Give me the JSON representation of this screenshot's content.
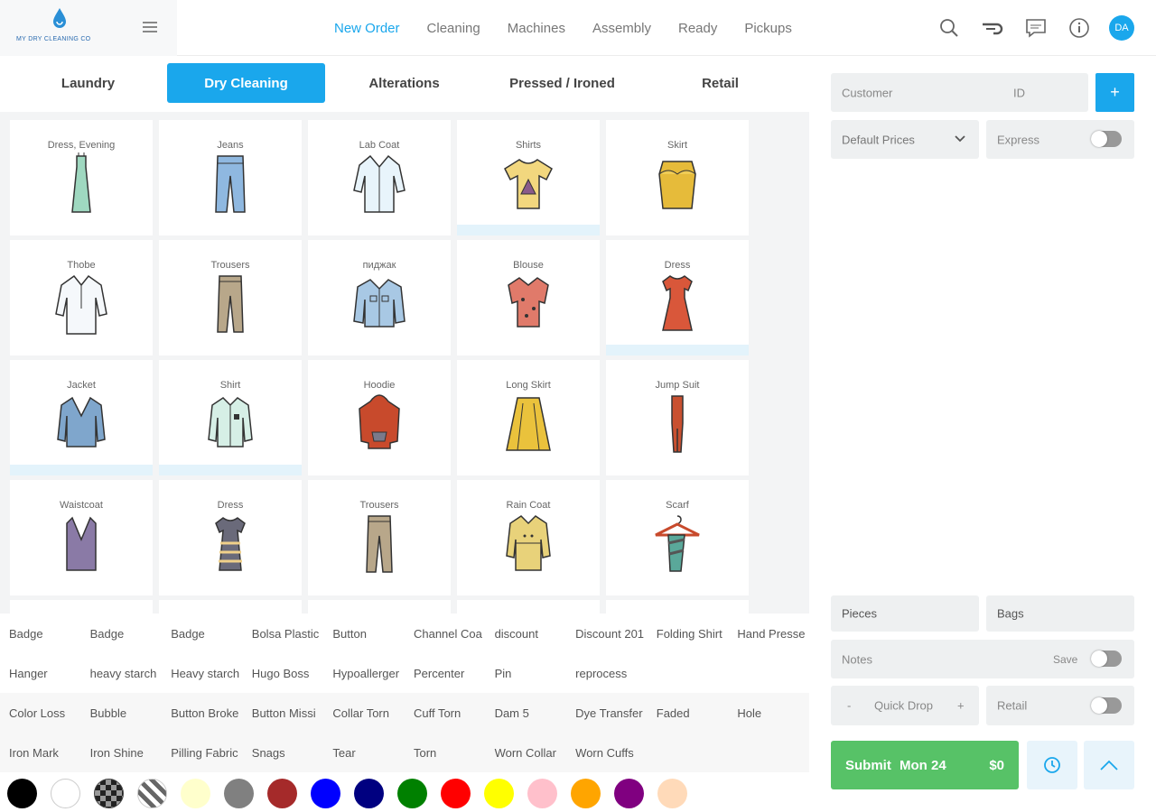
{
  "brand": {
    "name": "MY DRY CLEANING CO"
  },
  "nav": {
    "items": [
      {
        "label": "New Order"
      },
      {
        "label": "Cleaning"
      },
      {
        "label": "Machines"
      },
      {
        "label": "Assembly"
      },
      {
        "label": "Ready"
      },
      {
        "label": "Pickups"
      }
    ],
    "active": "New Order"
  },
  "user": {
    "initials": "DA"
  },
  "icons": [
    "menu-icon",
    "search-icon",
    "delivery-icon",
    "chat-icon",
    "info-icon"
  ],
  "categories": {
    "items": [
      {
        "label": "Laundry"
      },
      {
        "label": "Dry Cleaning"
      },
      {
        "label": "Alterations"
      },
      {
        "label": "Pressed / Ironed"
      },
      {
        "label": "Retail"
      }
    ],
    "active": "Dry Cleaning"
  },
  "items": [
    {
      "label": "Dress, Evening",
      "icon": "evening-dress-icon",
      "selected": false
    },
    {
      "label": "Jeans",
      "icon": "jeans-icon",
      "selected": false
    },
    {
      "label": "Lab Coat",
      "icon": "lab-coat-icon",
      "selected": false
    },
    {
      "label": "Shirts",
      "icon": "tshirt-icon",
      "selected": true
    },
    {
      "label": "Skirt",
      "icon": "skirt-icon",
      "selected": false
    },
    {
      "label": "Thobe",
      "icon": "thobe-icon",
      "selected": false
    },
    {
      "label": "Trousers",
      "icon": "trousers-icon",
      "selected": false
    },
    {
      "label": "пиджак",
      "icon": "denim-jacket-icon",
      "selected": false
    },
    {
      "label": "Blouse",
      "icon": "blouse-icon",
      "selected": false
    },
    {
      "label": "Dress",
      "icon": "dress-icon",
      "selected": true
    },
    {
      "label": "Jacket",
      "icon": "blazer-icon",
      "selected": true
    },
    {
      "label": "Shirt",
      "icon": "shirt-icon",
      "selected": true
    },
    {
      "label": "Hoodie",
      "icon": "hoodie-icon",
      "selected": false
    },
    {
      "label": "Long Skirt",
      "icon": "long-skirt-icon",
      "selected": false
    },
    {
      "label": "Jump Suit",
      "icon": "jumpsuit-icon",
      "selected": false
    },
    {
      "label": "Waistcoat",
      "icon": "waistcoat-icon",
      "selected": false
    },
    {
      "label": "Dress",
      "icon": "striped-dress-icon",
      "selected": false
    },
    {
      "label": "Trousers",
      "icon": "trousers-icon",
      "selected": false
    },
    {
      "label": "Rain Coat",
      "icon": "raincoat-icon",
      "selected": false
    },
    {
      "label": "Scarf",
      "icon": "scarf-hanger-icon",
      "selected": false
    }
  ],
  "tags": [
    [
      "Badge",
      "Badge",
      "Badge",
      "Bolsa Plastic",
      "Button",
      "Channel Coa",
      "discount",
      "Discount 201",
      "Folding Shirt",
      "Hand Presse"
    ],
    [
      "Hanger",
      "heavy starch",
      "Heavy starch",
      "Hugo Boss",
      "Hypoallerger",
      "Percenter",
      "Pin",
      "reprocess"
    ],
    [
      "Color Loss",
      "Bubble",
      "Button Broke",
      "Button Missi",
      "Collar Torn",
      "Cuff Torn",
      "Dam 5",
      "Dye Transfer",
      "Faded",
      "Hole"
    ],
    [
      "Iron Mark",
      "Iron Shine",
      "Pilling Fabric",
      "Snags",
      "Tear",
      "Torn",
      "Worn Collar",
      "Worn Cuffs"
    ]
  ],
  "colors": [
    "#000000",
    "#ffffff",
    "checkered",
    "striped",
    "#ffffcc",
    "#808080",
    "#a52a2a",
    "#0000ff",
    "#000080",
    "#008000",
    "#ff0000",
    "#ffff00",
    "#ffc0cb",
    "#ffa500",
    "#800080",
    "#ffdab9"
  ],
  "panel": {
    "customer_placeholder": "Customer",
    "id_placeholder": "ID",
    "add_label": "+",
    "price_list": "Default Prices",
    "express_label": "Express",
    "pieces_placeholder": "Pieces",
    "bags_placeholder": "Bags",
    "notes_placeholder": "Notes",
    "save_label": "Save",
    "quick_drop_minus": "-",
    "quick_drop_label": "Quick Drop",
    "quick_drop_plus": "+",
    "retail_label": "Retail",
    "submit_label": "Submit",
    "submit_date": "Mon 24",
    "submit_total": "$0"
  }
}
